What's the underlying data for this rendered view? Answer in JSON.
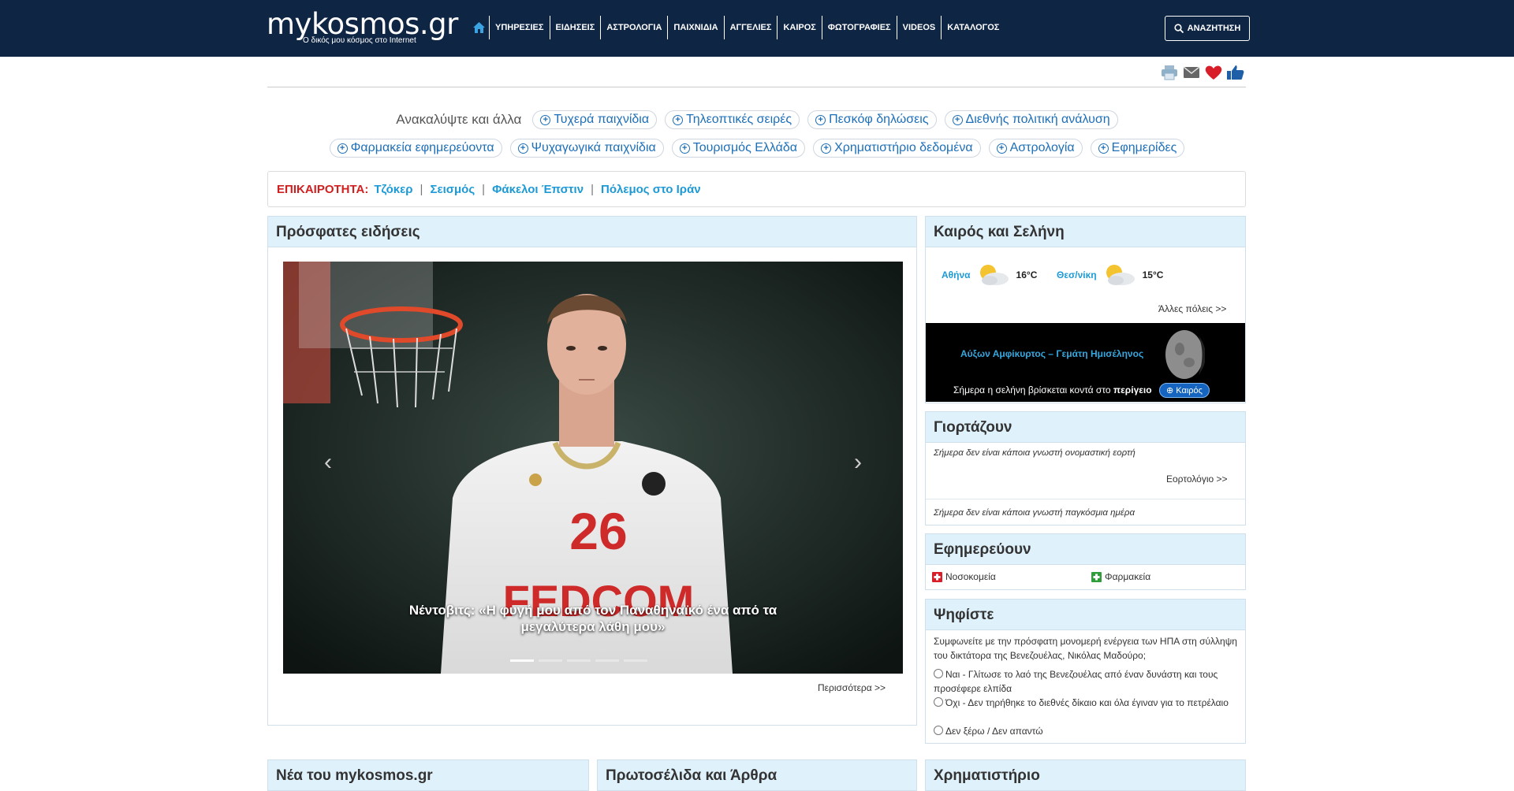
{
  "header": {
    "logo_text": "mykosmos.gr",
    "logo_tagline": "Ο δικός μου κόσμος στο Internet",
    "nav": [
      "ΥΠΗΡΕΣΙΕΣ",
      "ΕΙΔΗΣΕΙΣ",
      "ΑΣΤΡΟΛΟΓΙΑ",
      "ΠΑΙΧΝΙΔΙΑ",
      "ΑΓΓΕΛΙΕΣ",
      "ΚΑΙΡΟΣ",
      "ΦΩΤΟΓΡΑΦΙΕΣ",
      "VIDEOS",
      "ΚΑΤΑΛΟΓΟΣ"
    ],
    "search_label": "ΑΝΑΖΗΤΗΣΗ",
    "bg_color": "#0f2544"
  },
  "discover": {
    "label": "Ανακαλύψτε και άλλα",
    "row1": [
      "Τυχερά παιχνίδια",
      "Τηλεοπτικές σειρές",
      "Πεσκόφ δηλώσεις",
      "Διεθνής πολιτική ανάλυση"
    ],
    "row2": [
      "Φαρμακεία εφημερεύοντα",
      "Ψυχαγωγικά παιχνίδια",
      "Τουρισμός Ελλάδα",
      "Χρηματιστήριο δεδομένα",
      "Αστρολογία",
      "Εφημερίδες"
    ]
  },
  "current": {
    "label": "ΕΠΙΚΑΙΡΟΤΗΤΑ:",
    "links": [
      "Τζόκερ",
      "Σεισμός",
      "Φάκελοι Έπστιν",
      "Πόλεμος στο Ιράν"
    ]
  },
  "news": {
    "title": "Πρόσφατες ειδήσεις",
    "caption": "Νέντοβιτς: «Η φυγή μου από τον Παναθηναϊκό ένα από τα μεγαλύτερα λάθη μου»",
    "jersey_number": "26",
    "jersey_sponsor": "FEDCOM",
    "more": "Περισσότερα >>"
  },
  "weather": {
    "title": "Καιρός και Σελήνη",
    "cities": [
      {
        "name": "Αθήνα",
        "temp": "16°C"
      },
      {
        "name": "Θεσ/νίκη",
        "temp": "15°C"
      }
    ],
    "other_cities": "Άλλες πόλεις >>",
    "moon_title": "Αύξων Αμφίκυρτος – Γεμάτη Ημισέληνος",
    "moon_text_prefix": "Σήμερα η σελήνη βρίσκεται κοντά στο",
    "moon_text_bold": "περίγειο",
    "moon_button": "Καιρός"
  },
  "namedays": {
    "title": "Γιορτάζουν",
    "text1": "Σήμερα δεν είναι κάποια γνωστή ονομαστική εορτή",
    "link": "Εορτολόγιο >>",
    "text2": "Σήμερα δεν είναι κάποια γνωστή παγκόσμια ημέρα"
  },
  "duty": {
    "title": "Εφημερεύουν",
    "hospitals": "Νοσοκομεία",
    "pharmacies": "Φαρμακεία"
  },
  "poll": {
    "title": "Ψηφίστε",
    "question": "Συμφωνείτε με την πρόσφατη μονομερή ενέργεια των ΗΠΑ στη σύλληψη του δικτάτορα της Βενεζουέλας, Νικόλας Μαδούρο;",
    "options": [
      "Ναι - Γλίτωσε το λαό της Βενεζουέλας από έναν δυνάστη και τους προσέφερε ελπίδα",
      "Όχι - Δεν τηρήθηκε το διεθνές δίκαιο και όλα έγιναν για το πετρέλαιο",
      "Δεν ξέρω / Δεν απαντώ"
    ]
  },
  "bottom": {
    "col1": "Νέα του mykosmos.gr",
    "col2": "Πρωτοσέλιδα και Άρθρα",
    "col3": "Χρηματιστήριο"
  }
}
